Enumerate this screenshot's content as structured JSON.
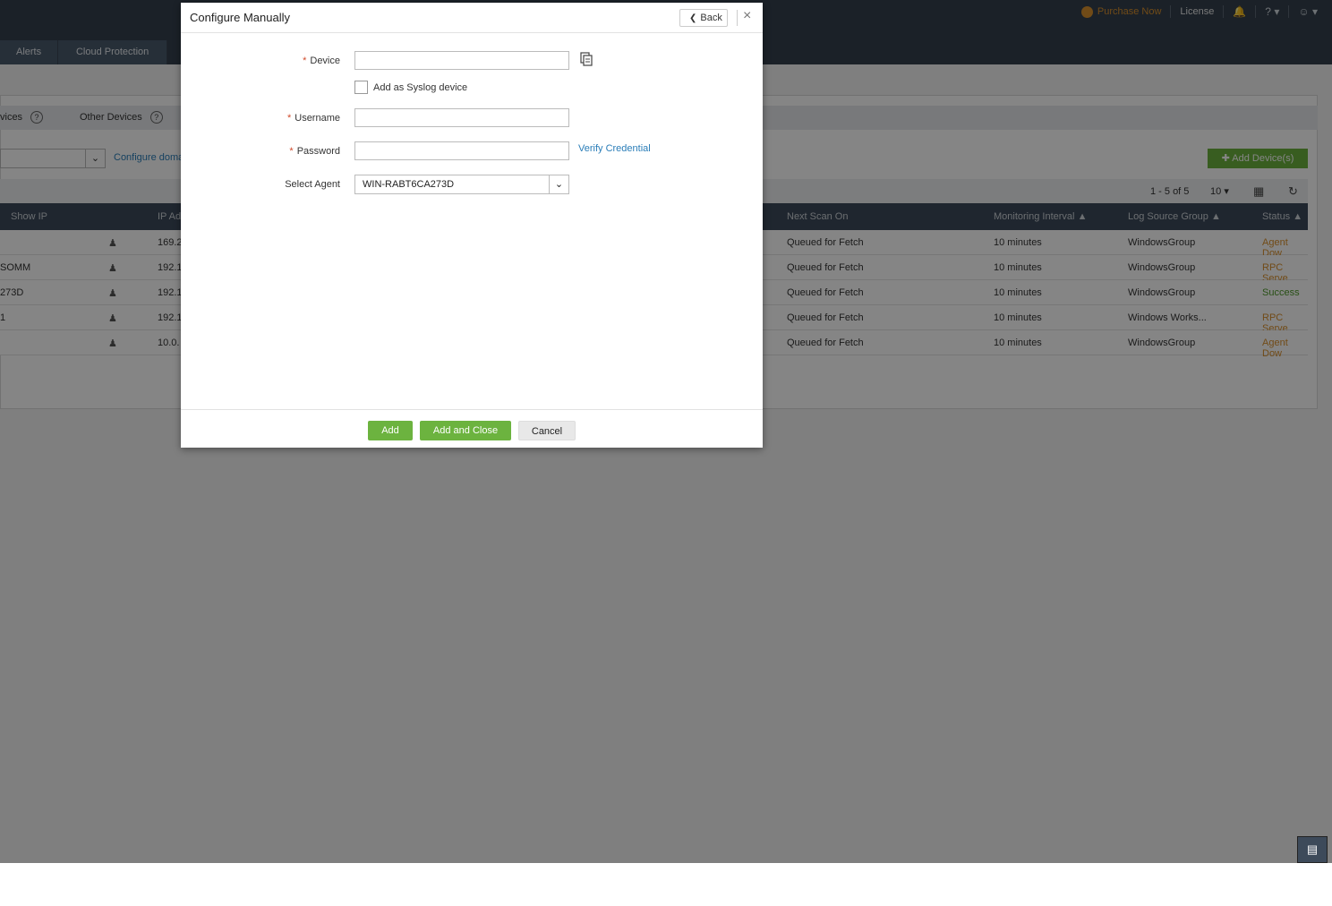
{
  "header": {
    "purchase_now": "Purchase Now",
    "license": "License",
    "help": "?",
    "tabs": [
      "Alerts",
      "Cloud Protection"
    ]
  },
  "subnav": {
    "devices": "vices",
    "other_devices": "Other Devices"
  },
  "toolbar": {
    "configure_domain": "Configure doma",
    "add_devices": "Add Device(s)",
    "pager": "1 - 5 of 5",
    "page_size": "10"
  },
  "table": {
    "columns": {
      "show_ip": "Show IP",
      "ip_address": "IP Ad",
      "next_scan_on": "Next Scan On",
      "monitoring_interval": "Monitoring Interval",
      "log_source_group": "Log Source Group",
      "status": "Status"
    },
    "rows": [
      {
        "name": "",
        "ip": "169.2",
        "next_scan": "Queued for Fetch",
        "interval": "10 minutes",
        "group": "WindowsGroup",
        "status": "Agent Dow",
        "status_type": "warn"
      },
      {
        "name": "SOMM",
        "ip": "192.1",
        "next_scan": "Queued for Fetch",
        "interval": "10 minutes",
        "group": "WindowsGroup",
        "status": "RPC Serve",
        "status_type": "warn"
      },
      {
        "name": "273D",
        "ip": "192.1",
        "next_scan": "Queued for Fetch",
        "interval": "10 minutes",
        "group": "WindowsGroup",
        "status": "Success",
        "status_type": "ok"
      },
      {
        "name": "1",
        "ip": "192.1",
        "next_scan": "Queued for Fetch",
        "interval": "10 minutes",
        "group": "Windows Works...",
        "status": "RPC Serve",
        "status_type": "warn"
      },
      {
        "name": "",
        "ip": "10.0.",
        "next_scan": "Queued for Fetch",
        "interval": "10 minutes",
        "group": "WindowsGroup",
        "status": "Agent Dow",
        "status_type": "warn"
      }
    ]
  },
  "modal": {
    "title": "Configure Manually",
    "back": "Back",
    "close": "×",
    "device_label": "Device",
    "device_value": "",
    "syslog_label": "Add as Syslog device",
    "syslog_checked": false,
    "username_label": "Username",
    "username_value": "",
    "password_label": "Password",
    "password_value": "",
    "verify_credential": "Verify Credential",
    "agent_label": "Select Agent",
    "agent_value": "WIN-RABT6CA273D",
    "buttons": {
      "add": "Add",
      "add_close": "Add and Close",
      "cancel": "Cancel"
    }
  },
  "colors": {
    "header_bg": "#34404e",
    "accent_green": "#6cb33f",
    "link_blue": "#2a7db8",
    "warn_orange": "#d9902c",
    "success_green": "#4f9a2b"
  }
}
